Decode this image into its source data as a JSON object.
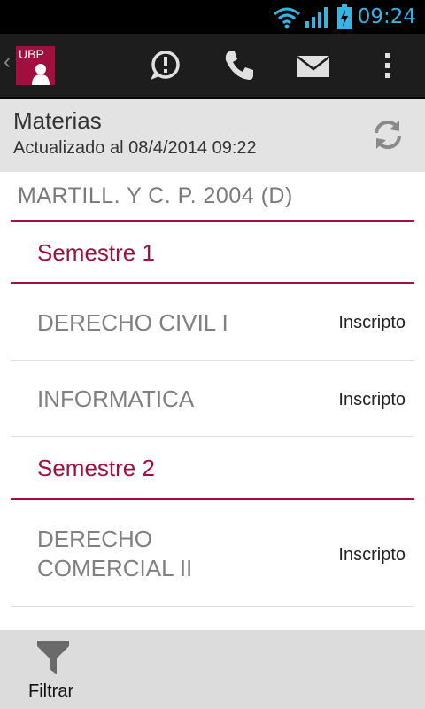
{
  "status_bar": {
    "time": "09:24"
  },
  "action_bar": {
    "logo_text": "UBP"
  },
  "header": {
    "title": "Materias",
    "updated": "Actualizado al 08/4/2014 09:22"
  },
  "career": "MARTILL. Y C. P. 2004 (D)",
  "semesters": [
    {
      "label": "Semestre 1",
      "subjects": [
        {
          "name": "DERECHO CIVIL I",
          "status": "Inscripto"
        },
        {
          "name": "INFORMATICA",
          "status": "Inscripto"
        }
      ]
    },
    {
      "label": "Semestre 2",
      "subjects": [
        {
          "name_line1": "DERECHO",
          "name_line2": "COMERCIAL II",
          "status": "Inscripto"
        }
      ]
    }
  ],
  "bottom_bar": {
    "filter_label": "Filtrar"
  },
  "colors": {
    "accent": "#a00f3d",
    "status_blue": "#33b5e5"
  }
}
